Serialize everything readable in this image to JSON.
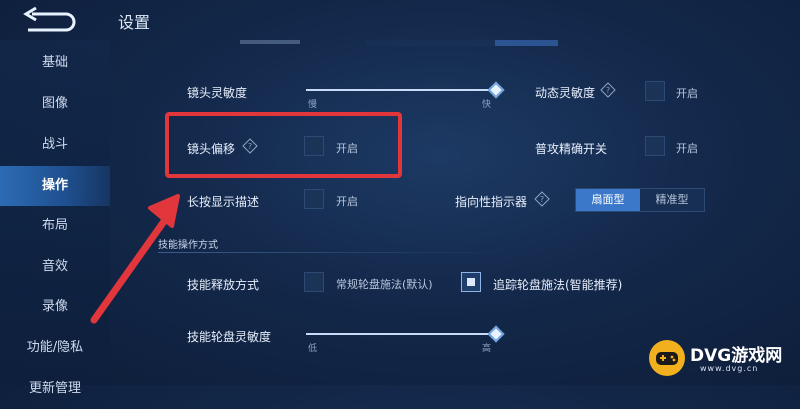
{
  "header": {
    "title": "设置"
  },
  "sidebar": {
    "items": [
      {
        "label": "基础"
      },
      {
        "label": "图像"
      },
      {
        "label": "战斗"
      },
      {
        "label": "操作",
        "active": true
      },
      {
        "label": "布局"
      },
      {
        "label": "音效"
      },
      {
        "label": "录像"
      },
      {
        "label": "功能/隐私"
      },
      {
        "label": "更新管理"
      }
    ]
  },
  "settings": {
    "camera_sensitivity": {
      "label": "镜头灵敏度",
      "min_label": "慢",
      "max_label": "快",
      "value": 1.0
    },
    "dynamic_sensitivity": {
      "label": "动态灵敏度",
      "checkbox_label": "开启",
      "checked": false
    },
    "camera_offset": {
      "label": "镜头偏移",
      "checkbox_label": "开启",
      "checked": false
    },
    "normal_attack_precise": {
      "label": "普攻精确开关",
      "checkbox_label": "开启",
      "checked": false
    },
    "long_press_desc": {
      "label": "长按显示描述",
      "checkbox_label": "开启",
      "checked": false
    },
    "direction_indicator": {
      "label": "指向性指示器",
      "options": [
        "扇面型",
        "精准型"
      ],
      "selected": "扇面型"
    },
    "skill_section": {
      "heading": "技能操作方式"
    },
    "skill_release": {
      "label": "技能释放方式",
      "option1": {
        "label": "常规轮盘施法(默认)",
        "checked": false
      },
      "option2": {
        "label": "追踪轮盘施法(智能推荐)",
        "checked": true
      }
    },
    "skill_wheel_sensitivity": {
      "label": "技能轮盘灵敏度",
      "min_label": "低",
      "max_label": "高",
      "value": 1.0
    }
  },
  "watermark": {
    "text": "DVG游戏网",
    "sub": "www.dvg.cn"
  },
  "colors": {
    "accent": "#3c78c9",
    "annotation_red": "#e0363c",
    "background": "#13284a"
  }
}
